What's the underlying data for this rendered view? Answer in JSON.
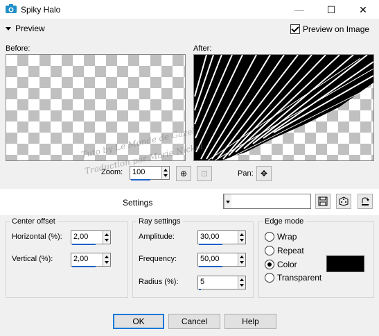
{
  "window": {
    "title": "Spiky Halo",
    "buttons": {
      "minimize": "—",
      "maximize": "☐",
      "close": "✕"
    }
  },
  "preview": {
    "toggle_label": "Preview",
    "preview_on_image_label": "Preview on Image",
    "preview_on_image_checked": true,
    "before_label": "Before:",
    "after_label": "After:",
    "zoom_label": "Zoom:",
    "zoom_value": "100",
    "pan_label": "Pan:"
  },
  "settings": {
    "label": "Settings",
    "preset_value": ""
  },
  "center_offset": {
    "title": "Center offset",
    "horizontal_label": "Horizontal (%):",
    "horizontal_value": "2,00",
    "vertical_label": "Vertical (%):",
    "vertical_value": "2,00"
  },
  "ray_settings": {
    "title": "Ray settings",
    "amplitude_label": "Amplitude:",
    "amplitude_value": "30,00",
    "frequency_label": "Frequency:",
    "frequency_value": "50,00",
    "radius_label": "Radius (%):",
    "radius_value": "5"
  },
  "edge_mode": {
    "title": "Edge mode",
    "options": [
      "Wrap",
      "Repeat",
      "Color",
      "Transparent"
    ],
    "selected": "Color",
    "color": "#000000"
  },
  "footer": {
    "ok": "OK",
    "cancel": "Cancel",
    "help": "Help"
  },
  "watermark": {
    "line1": "Tuto by Le Monde de Gazel",
    "line2": "Traduction par Marie Nickol"
  }
}
